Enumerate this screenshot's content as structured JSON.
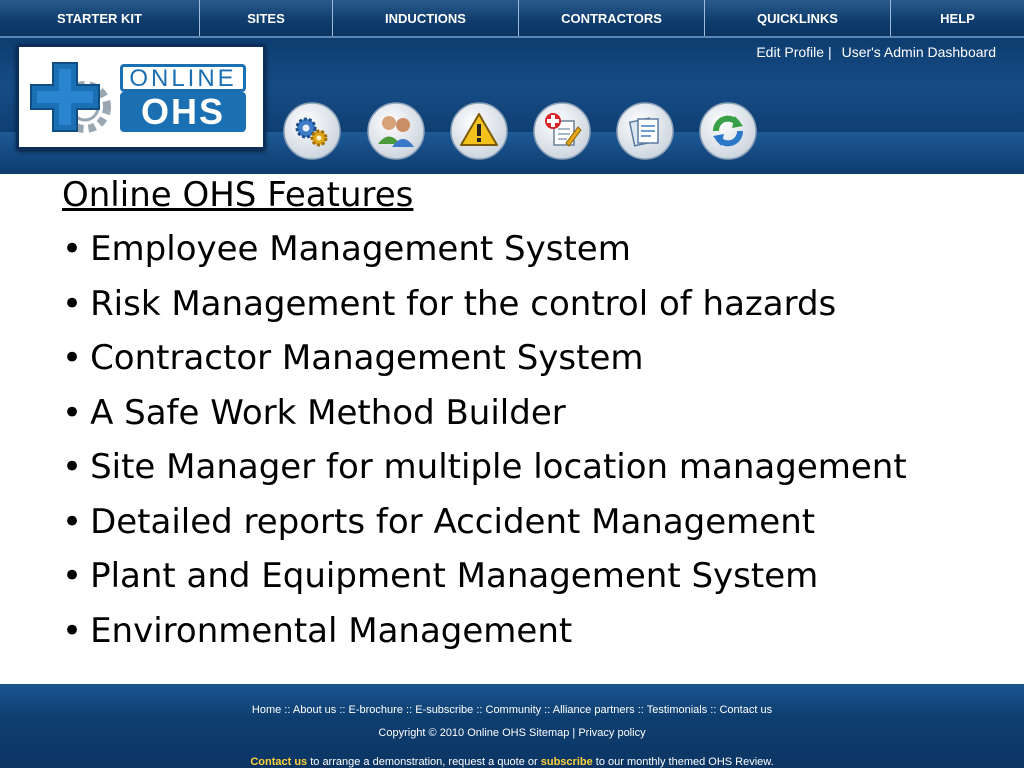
{
  "nav": {
    "items": [
      "STARTER KIT",
      "SITES",
      "INDUCTIONS",
      "CONTRACTORS",
      "QUICKLINKS",
      "HELP"
    ]
  },
  "header": {
    "edit_profile": "Edit Profile",
    "separator": "|",
    "admin_dashboard": "User's Admin Dashboard",
    "logo_online": "ONLINE",
    "logo_ohs": "OHS"
  },
  "toolbar": {
    "icons": [
      "gears-icon",
      "users-icon",
      "warning-icon",
      "medical-report-icon",
      "documents-icon",
      "refresh-icon"
    ]
  },
  "content": {
    "title": "Online OHS Features",
    "bullet": "•",
    "features": [
      "Employee Management System",
      "Risk Management for the control of hazards",
      "Contractor Management System",
      "A Safe Work Method Builder",
      "Site Manager for multiple location management",
      "Detailed reports for Accident Management",
      "Plant and Equipment Management System",
      "Environmental Management"
    ]
  },
  "footer": {
    "links": [
      "Home",
      "About us",
      "E-brochure",
      "E-subscribe",
      "Community",
      "Alliance partners",
      "Testimonials",
      "Contact us"
    ],
    "link_separator": " :: ",
    "copyright": "Copyright © 2010 Online OHS",
    "sitemap": "Sitemap",
    "privacy": "Privacy policy",
    "cta_contact": "Contact us",
    "cta_middle": " to arrange a demonstration, request a quote or ",
    "cta_subscribe": "subscribe",
    "cta_end": " to our monthly themed OHS Review."
  },
  "colors": {
    "nav_bg": "#0f3e6e",
    "header_bg": "#164c85",
    "logo_blue": "#1b6fb3",
    "footer_highlight": "#ffd23a"
  }
}
